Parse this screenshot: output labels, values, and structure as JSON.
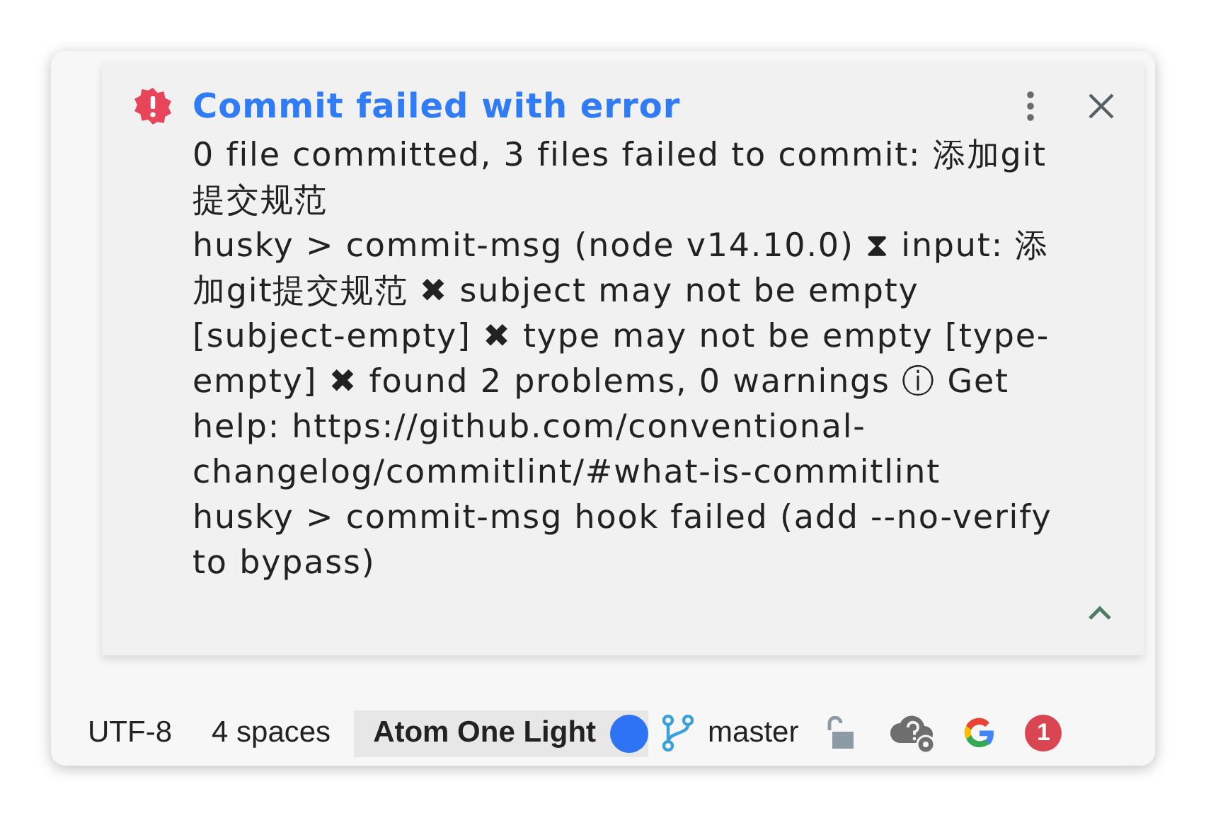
{
  "notification": {
    "title": "Commit failed with error",
    "paragraphs": [
      "0 file committed, 3 files failed to commit: 添加git提交规范",
      "husky > commit-msg (node v14.10.0) ⧗ input: 添加git提交规范 ✖ subject may not be empty [subject-empty] ✖ type may not be empty [type-empty] ✖ found 2 problems, 0 warnings ⓘ Get help: https://github.com/conventional-changelog/commitlint/#what-is-commitlint",
      "husky > commit-msg hook failed (add --no-verify to bypass)"
    ],
    "expanded": true
  },
  "status_bar": {
    "encoding": "UTF-8",
    "indent": "4 spaces",
    "theme": {
      "label": "Atom One Light",
      "color": "#2f73f5"
    },
    "branch": "master",
    "notifications_count": "1"
  }
}
